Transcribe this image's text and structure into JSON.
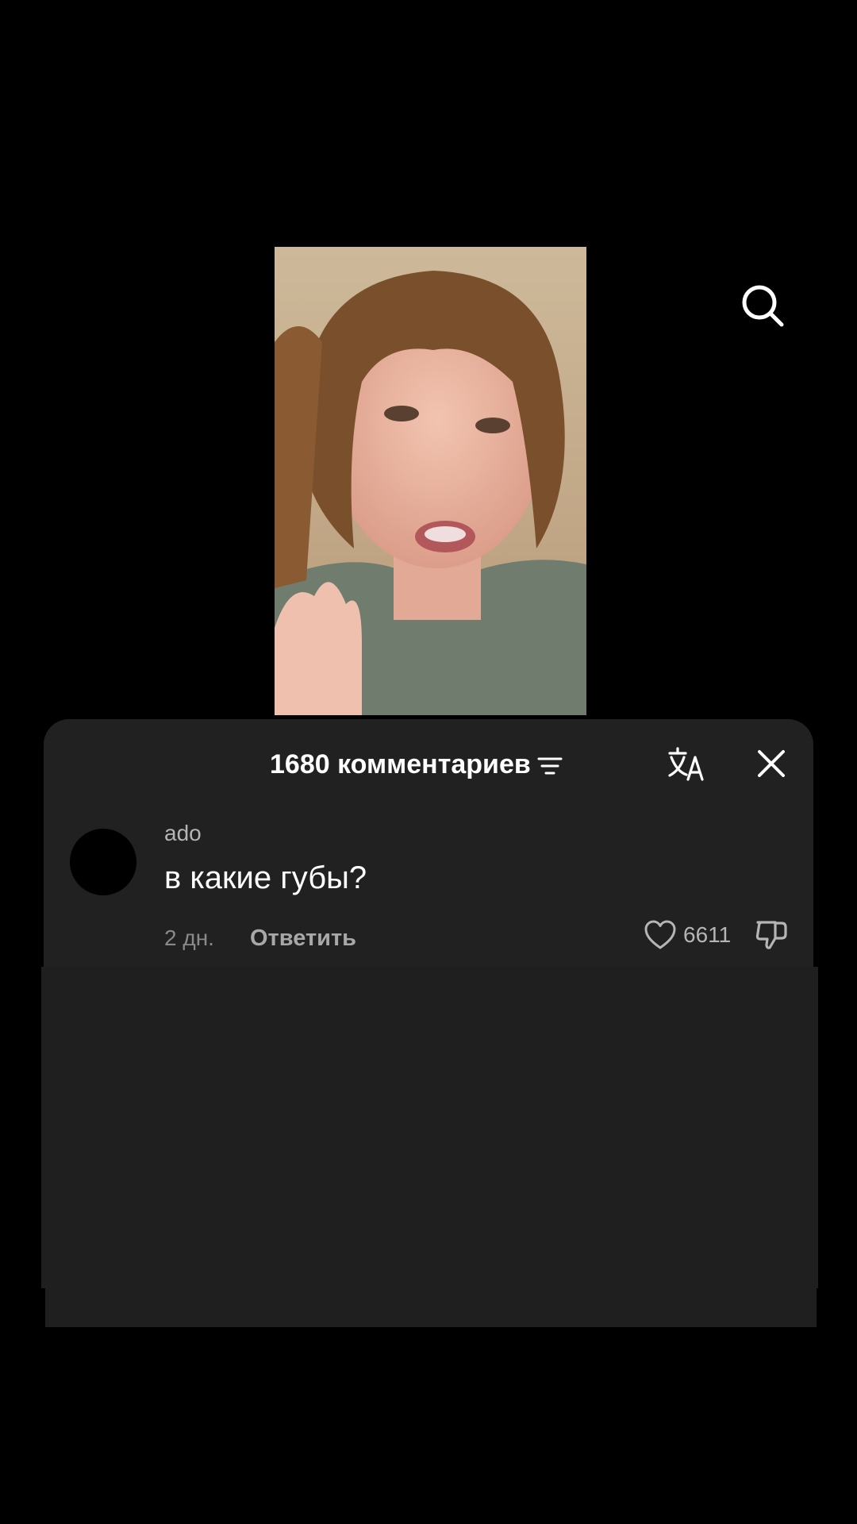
{
  "header": {
    "comments_title": "1680 комментариев"
  },
  "comment": {
    "username": "ado",
    "text": "в какие губы?",
    "time": "2 дн.",
    "reply_label": "Ответить",
    "like_count": "6611"
  },
  "icons": {
    "search": "search-icon",
    "sort": "sort-lines-icon",
    "translate": "translate-icon",
    "close": "close-icon",
    "heart": "heart-icon",
    "dislike": "thumbs-down-icon"
  },
  "colors": {
    "background": "#000000",
    "sheet": "#212121",
    "text_primary": "#ffffff",
    "text_secondary": "#b5b5b5",
    "text_muted": "#8a8a8a"
  }
}
